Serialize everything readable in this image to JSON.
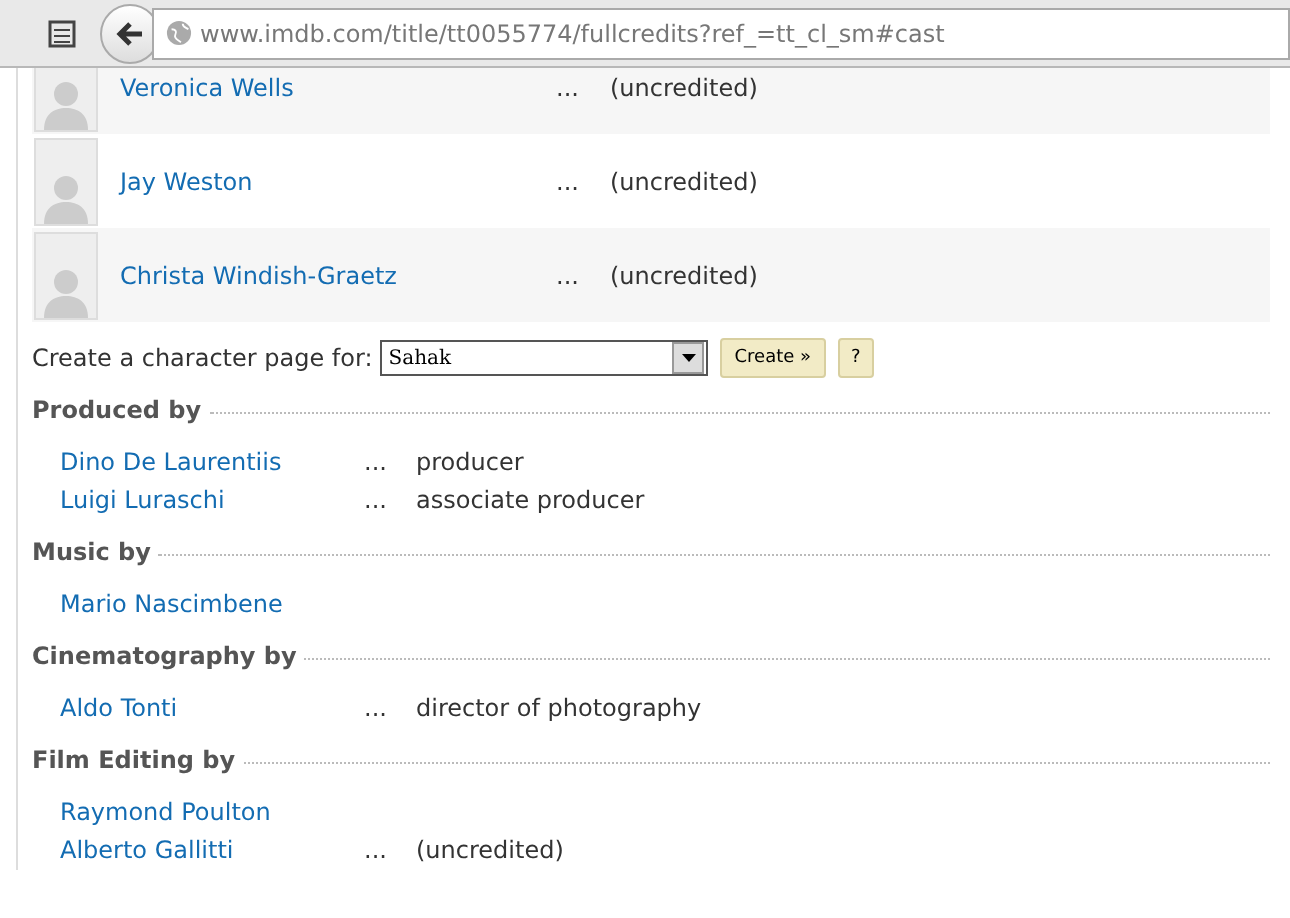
{
  "browser": {
    "url": "www.imdb.com/title/tt0055774/fullcredits?ref_=tt_cl_sm#cast"
  },
  "cast": [
    {
      "name": "Veronica Wells",
      "dots": "...",
      "role": "(uncredited)"
    },
    {
      "name": "Jay Weston",
      "dots": "...",
      "role": "(uncredited)"
    },
    {
      "name": "Christa Windish-Graetz",
      "dots": "...",
      "role": "(uncredited)"
    }
  ],
  "character_page": {
    "label": "Create a character page for:",
    "value": "Sahak",
    "create_button": "Create »",
    "help_button": "?"
  },
  "sections": [
    {
      "title": "Produced by",
      "people": [
        {
          "name": "Dino De Laurentiis",
          "dots": "...",
          "role": "producer"
        },
        {
          "name": "Luigi Luraschi",
          "dots": "...",
          "role": "associate producer"
        }
      ]
    },
    {
      "title": "Music by",
      "people": [
        {
          "name": "Mario Nascimbene"
        }
      ]
    },
    {
      "title": "Cinematography by",
      "people": [
        {
          "name": "Aldo Tonti",
          "dots": "...",
          "role": "director of photography"
        }
      ]
    },
    {
      "title": "Film Editing by",
      "people": [
        {
          "name": "Raymond Poulton"
        },
        {
          "name": "Alberto Gallitti",
          "dots": "...",
          "role": "(uncredited)"
        }
      ]
    }
  ]
}
